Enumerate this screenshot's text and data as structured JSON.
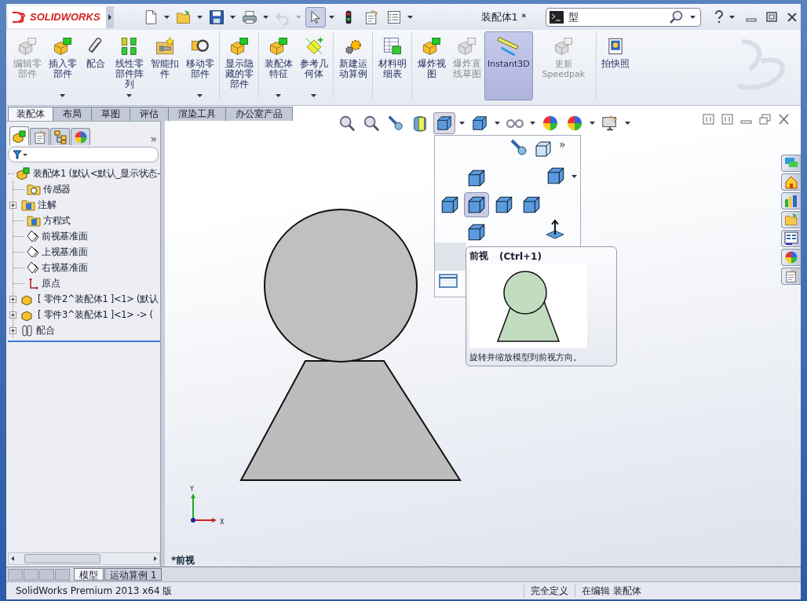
{
  "title_bar": {
    "logo": "SOLIDWORKS",
    "quick_access": [
      {
        "dropdown": true,
        "disabled": false,
        "selected": false
      },
      {
        "dropdown": true,
        "disabled": false,
        "selected": false
      },
      {
        "dropdown": true,
        "disabled": false,
        "selected": false
      },
      {
        "dropdown": true,
        "disabled": false,
        "selected": false
      },
      {
        "dropdown": true,
        "disabled": true,
        "selected": false
      },
      {
        "dropdown": true,
        "disabled": false,
        "selected": true
      },
      {
        "dropdown": false,
        "disabled": false,
        "selected": false
      },
      {
        "dropdown": false,
        "disabled": false,
        "selected": false
      },
      {
        "dropdown": true,
        "disabled": false,
        "selected": false
      }
    ],
    "document_title": "装配体1 *",
    "search": {
      "value": "型"
    }
  },
  "ribbon": [
    {
      "label": "编辑零部件",
      "disabled": true,
      "selected": false,
      "dropdown": false
    },
    {
      "label": "插入零部件",
      "disabled": false,
      "selected": false,
      "dropdown": true
    },
    {
      "label": "配合",
      "disabled": false,
      "selected": false,
      "dropdown": false
    },
    {
      "label": "线性零部件阵列",
      "disabled": false,
      "selected": false,
      "dropdown": true
    },
    {
      "label": "智能扣件",
      "disabled": false,
      "selected": false,
      "dropdown": false
    },
    {
      "label": "移动零部件",
      "disabled": false,
      "selected": false,
      "dropdown": true
    },
    {
      "label": "显示隐藏的零部件",
      "disabled": false,
      "selected": false,
      "dropdown": false
    },
    {
      "label": "装配体特征",
      "disabled": false,
      "selected": false,
      "dropdown": true
    },
    {
      "label": "参考几何体",
      "disabled": false,
      "selected": false,
      "dropdown": true
    },
    {
      "label": "新建运动算例",
      "disabled": false,
      "selected": false,
      "dropdown": false
    },
    {
      "label": "材料明细表",
      "disabled": false,
      "selected": false,
      "dropdown": false
    },
    {
      "label": "爆炸视图",
      "disabled": false,
      "selected": false,
      "dropdown": false
    },
    {
      "label": "爆炸直线草图",
      "disabled": true,
      "selected": false,
      "dropdown": false
    },
    {
      "label": "Instant3D",
      "disabled": false,
      "selected": true,
      "dropdown": false
    },
    {
      "label": "更新 Speedpak",
      "disabled": true,
      "selected": false,
      "dropdown": false
    },
    {
      "label": "拍快照",
      "disabled": false,
      "selected": false,
      "dropdown": false
    }
  ],
  "command_tabs": [
    {
      "label": "装配体",
      "selected": true
    },
    {
      "label": "布局",
      "selected": false
    },
    {
      "label": "草图",
      "selected": false
    },
    {
      "label": "评估",
      "selected": false
    },
    {
      "label": "渲染工具",
      "selected": false
    },
    {
      "label": "办公室产品",
      "selected": false
    }
  ],
  "feature_manager": {
    "panel_tabs": [
      {
        "selected": true
      },
      {
        "selected": false
      },
      {
        "selected": false
      },
      {
        "selected": false
      }
    ],
    "more": "»",
    "tree": {
      "label": "装配体1  (默认<默认_显示状态-",
      "kind": "assembly",
      "children": [
        {
          "label": "传感器",
          "kind": "sensor"
        },
        {
          "label": "注解",
          "kind": "annotation",
          "expanded": false
        },
        {
          "label": "方程式",
          "kind": "equation"
        },
        {
          "label": "前视基准面",
          "kind": "plane"
        },
        {
          "label": "上视基准面",
          "kind": "plane"
        },
        {
          "label": "右视基准面",
          "kind": "plane"
        },
        {
          "label": "原点",
          "kind": "origin"
        },
        {
          "label": "[ 零件2^装配体1 ]<1> (默认",
          "kind": "part",
          "expanded": false
        },
        {
          "label": "[ 零件3^装配体1 ]<1> -> (",
          "kind": "part",
          "expanded": false
        },
        {
          "label": "配合",
          "kind": "mates",
          "expanded": false
        }
      ]
    }
  },
  "view_toolbar": [
    {
      "selected": false
    },
    {
      "selected": false
    },
    {
      "selected": false
    },
    {
      "selected": false
    },
    {
      "selected": true
    },
    {
      "selected": false
    },
    {
      "selected": false
    },
    {
      "selected": false
    },
    {
      "selected": false
    },
    {
      "selected": false
    }
  ],
  "orientation_flyout": {
    "more": "»",
    "views": [
      {
        "selected": false
      },
      {
        "selected": false
      },
      {
        "selected": true
      },
      {
        "selected": false
      },
      {
        "selected": false
      },
      {
        "selected": false
      }
    ]
  },
  "tooltip": {
    "title": "前视",
    "shortcut": "(Ctrl+1)",
    "description": "旋转并缩放模型到前视方向。"
  },
  "graphics": {
    "axis_labels": [
      "Y",
      "X"
    ],
    "view_name": "*前视"
  },
  "bottom_tabs": [
    {
      "label": "模型",
      "selected": true
    },
    {
      "label": "运动算例 1",
      "selected": false
    }
  ],
  "status_bar": [
    "SolidWorks Premium 2013 x64 版",
    "完全定义",
    "在编辑 装配体"
  ]
}
